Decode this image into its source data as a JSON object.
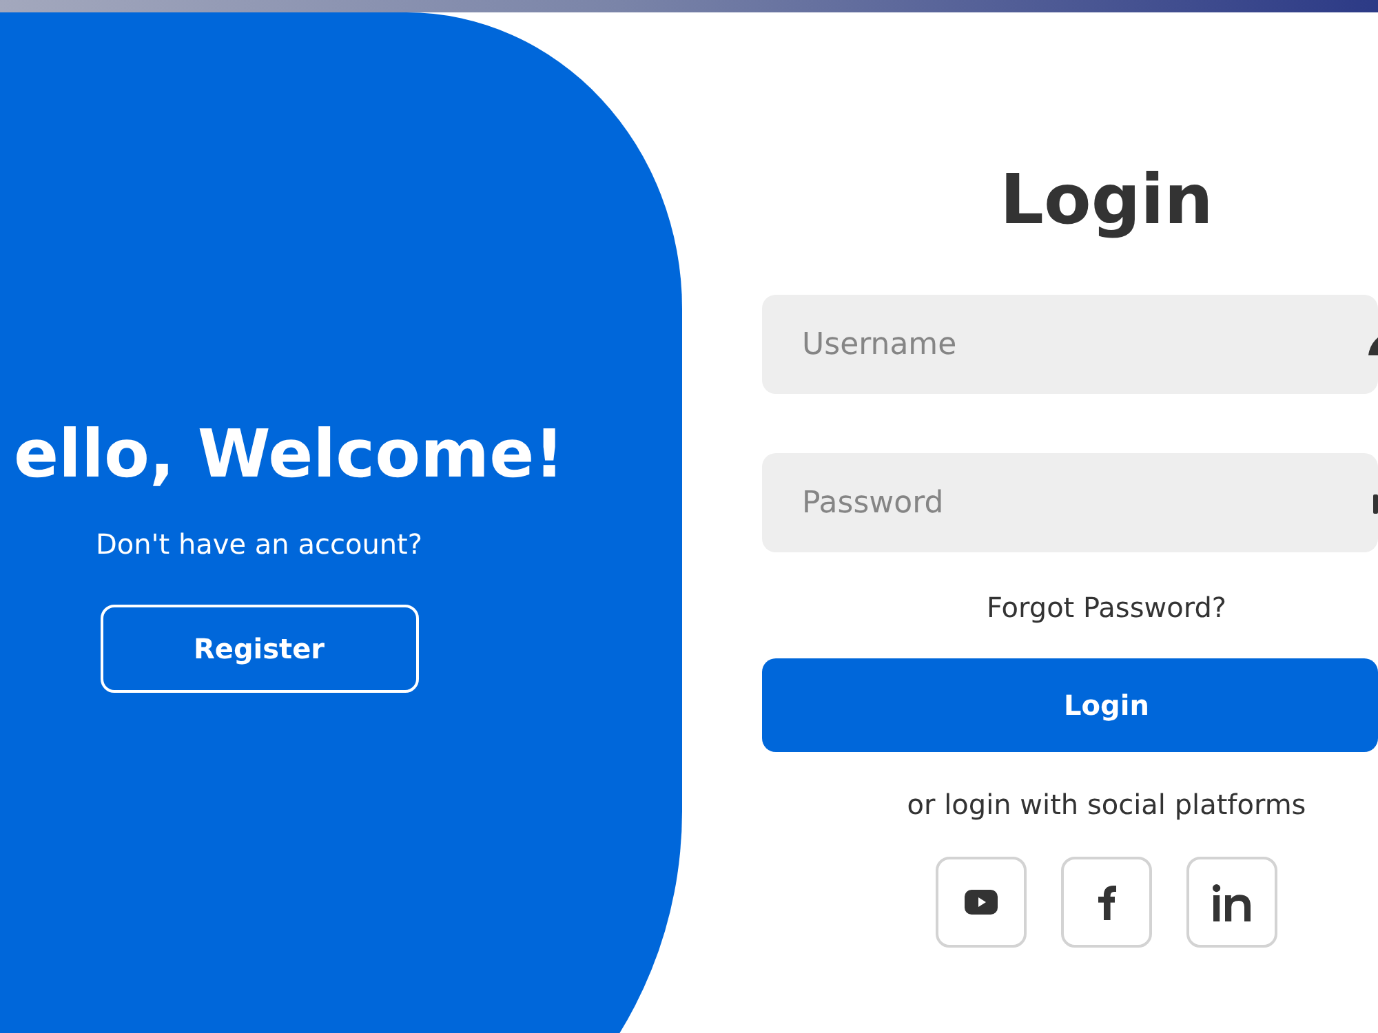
{
  "welcome_panel": {
    "heading": "ello, Welcome!",
    "prompt": "Don't have an account?",
    "register_button": "Register"
  },
  "login_form": {
    "title": "Login",
    "fields": [
      {
        "kind": "username",
        "placeholder": "Username"
      },
      {
        "kind": "password",
        "placeholder": "Password"
      }
    ],
    "forgot_link": "Forgot Password?",
    "submit_button": "Login",
    "social_prompt": "or login with social platforms",
    "social_buttons": [
      {
        "kind": "youtube"
      },
      {
        "kind": "facebook"
      },
      {
        "kind": "linkedin"
      }
    ]
  }
}
